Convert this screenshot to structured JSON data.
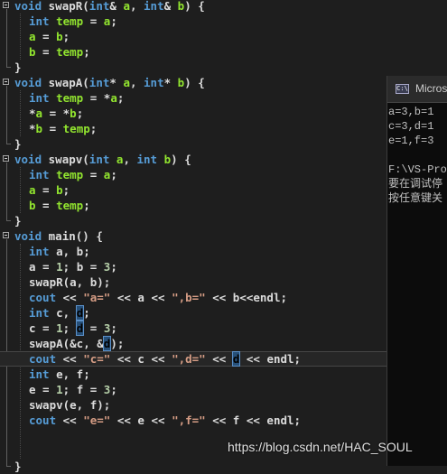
{
  "editor": {
    "lines": [
      [
        [
          "kw",
          "void "
        ],
        [
          "id",
          "swapR("
        ],
        [
          "kw",
          "int"
        ],
        [
          "sp",
          "& "
        ],
        [
          "var",
          "a"
        ],
        [
          "sp",
          ", "
        ],
        [
          "kw",
          "int"
        ],
        [
          "sp",
          "& "
        ],
        [
          "var",
          "b"
        ],
        [
          "sp",
          ") {"
        ]
      ],
      [
        [
          "kw",
          "int "
        ],
        [
          "var",
          "temp"
        ],
        [
          "sp",
          " = "
        ],
        [
          "var",
          "a"
        ],
        [
          "sp",
          ";"
        ]
      ],
      [
        [
          "var",
          "a"
        ],
        [
          "sp",
          " = "
        ],
        [
          "var",
          "b"
        ],
        [
          "sp",
          ";"
        ]
      ],
      [
        [
          "var",
          "b"
        ],
        [
          "sp",
          " = "
        ],
        [
          "var",
          "temp"
        ],
        [
          "sp",
          ";"
        ]
      ],
      [
        [
          "sp",
          "}"
        ]
      ],
      [
        [
          "kw",
          "void "
        ],
        [
          "id",
          "swapA("
        ],
        [
          "kw",
          "int"
        ],
        [
          "sp",
          "* "
        ],
        [
          "var",
          "a"
        ],
        [
          "sp",
          ", "
        ],
        [
          "kw",
          "int"
        ],
        [
          "sp",
          "* "
        ],
        [
          "var",
          "b"
        ],
        [
          "sp",
          ") {"
        ]
      ],
      [
        [
          "kw",
          "int "
        ],
        [
          "var",
          "temp"
        ],
        [
          "sp",
          " = *"
        ],
        [
          "var",
          "a"
        ],
        [
          "sp",
          ";"
        ]
      ],
      [
        [
          "sp",
          "*"
        ],
        [
          "var",
          "a"
        ],
        [
          "sp",
          " = *"
        ],
        [
          "var",
          "b"
        ],
        [
          "sp",
          ";"
        ]
      ],
      [
        [
          "sp",
          "*"
        ],
        [
          "var",
          "b"
        ],
        [
          "sp",
          " = "
        ],
        [
          "var",
          "temp"
        ],
        [
          "sp",
          ";"
        ]
      ],
      [
        [
          "sp",
          "}"
        ]
      ],
      [
        [
          "kw",
          "void "
        ],
        [
          "id",
          "swapv("
        ],
        [
          "kw",
          "int "
        ],
        [
          "var",
          "a"
        ],
        [
          "sp",
          ", "
        ],
        [
          "kw",
          "int "
        ],
        [
          "var",
          "b"
        ],
        [
          "sp",
          ") {"
        ]
      ],
      [
        [
          "kw",
          "int "
        ],
        [
          "var",
          "temp"
        ],
        [
          "sp",
          " = "
        ],
        [
          "var",
          "a"
        ],
        [
          "sp",
          ";"
        ]
      ],
      [
        [
          "var",
          "a"
        ],
        [
          "sp",
          " = "
        ],
        [
          "var",
          "b"
        ],
        [
          "sp",
          ";"
        ]
      ],
      [
        [
          "var",
          "b"
        ],
        [
          "sp",
          " = "
        ],
        [
          "var",
          "temp"
        ],
        [
          "sp",
          ";"
        ]
      ],
      [
        [
          "sp",
          "}"
        ]
      ],
      [
        [
          "kw",
          "void "
        ],
        [
          "id",
          "main() {"
        ]
      ],
      [
        [
          "kw",
          "int "
        ],
        [
          "id",
          "a, b;"
        ]
      ],
      [
        [
          "id",
          "a = "
        ],
        [
          "num",
          "1"
        ],
        [
          "id",
          "; b = "
        ],
        [
          "num",
          "3"
        ],
        [
          "id",
          ";"
        ]
      ],
      [
        [
          "id",
          "swapR(a, b);"
        ]
      ],
      [
        [
          "kw",
          "cout "
        ],
        [
          "sp",
          "<< "
        ],
        [
          "str",
          "\"a=\""
        ],
        [
          "sp",
          " << a << "
        ],
        [
          "str",
          "\",b=\""
        ],
        [
          "sp",
          " << b<<endl;"
        ]
      ],
      [
        [
          "kw",
          "int "
        ],
        [
          "id",
          "c, "
        ],
        [
          "sel",
          "d"
        ],
        [
          "sp",
          ";"
        ]
      ],
      [
        [
          "id",
          "c = "
        ],
        [
          "num",
          "1"
        ],
        [
          "id",
          "; "
        ],
        [
          "sel",
          "d"
        ],
        [
          "id",
          " = "
        ],
        [
          "num",
          "3"
        ],
        [
          "id",
          ";"
        ]
      ],
      [
        [
          "id",
          "swapA(&c, &"
        ],
        [
          "sel",
          "d"
        ],
        [
          "id",
          ");"
        ]
      ],
      [
        [
          "kw",
          "cout "
        ],
        [
          "sp",
          "<< "
        ],
        [
          "str",
          "\"c=\""
        ],
        [
          "sp",
          " << c << "
        ],
        [
          "str",
          "\",d=\""
        ],
        [
          "sp",
          " << "
        ],
        [
          "sel",
          "d"
        ],
        [
          "sp",
          " << endl;"
        ]
      ],
      [
        [
          "kw",
          "int "
        ],
        [
          "id",
          "e, f;"
        ]
      ],
      [
        [
          "id",
          "e = "
        ],
        [
          "num",
          "1"
        ],
        [
          "id",
          "; f = "
        ],
        [
          "num",
          "3"
        ],
        [
          "id",
          ";"
        ]
      ],
      [
        [
          "id",
          "swapv(e, f);"
        ]
      ],
      [
        [
          "kw",
          "cout "
        ],
        [
          "sp",
          "<< "
        ],
        [
          "str",
          "\"e=\""
        ],
        [
          "sp",
          " << e << "
        ],
        [
          "str",
          "\",f=\""
        ],
        [
          "sp",
          " << f << endl;"
        ]
      ],
      [
        [
          "sp",
          ""
        ]
      ],
      [
        [
          "sp",
          ""
        ]
      ],
      [
        [
          "sp",
          "}"
        ]
      ]
    ]
  },
  "console": {
    "title": "Micros",
    "icon_text": "C:\\",
    "output": "a=3,b=1\nc=3,d=1\ne=1,f=3\n\nF:\\VS-Pro\n要在调试停\n按任意键关"
  },
  "watermark": "https://blog.csdn.net/HAC_SOUL"
}
